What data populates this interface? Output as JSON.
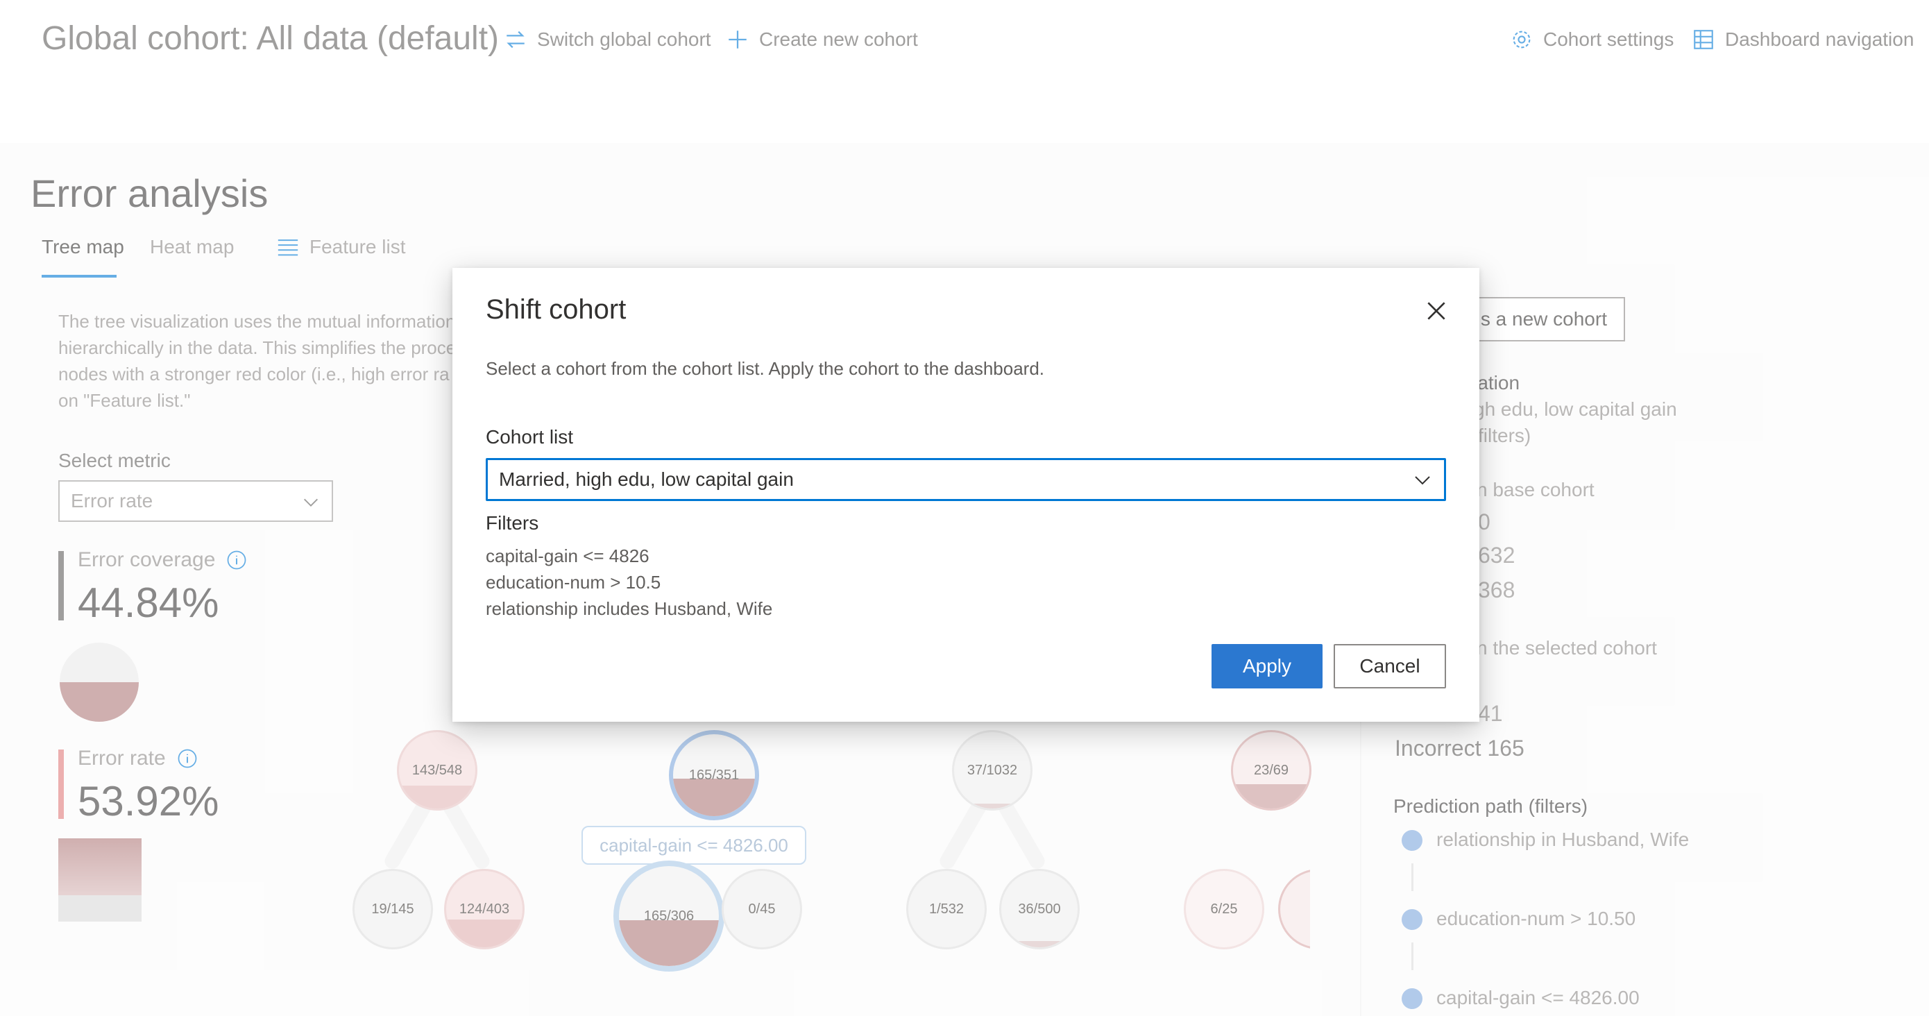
{
  "header": {
    "title": "Global cohort: All data (default)",
    "switch_cohort": "Switch global cohort",
    "create_cohort": "Create new cohort",
    "cohort_settings": "Cohort settings",
    "dashboard_navigation": "Dashboard navigation"
  },
  "error_analysis": {
    "title": "Error analysis",
    "tabs": [
      {
        "label": "Tree map",
        "active": true
      },
      {
        "label": "Heat map",
        "active": false
      },
      {
        "label": "Feature list",
        "active": false
      }
    ],
    "description_lines": [
      "The tree visualization uses the mutual information",
      "hierarchically in the data. This simplifies the proce",
      "nodes with a stronger red color (i.e., high error ra",
      "on \"Feature list.\""
    ],
    "select_metric_label": "Select metric",
    "select_metric_value": "Error rate",
    "error_coverage_label": "Error coverage",
    "error_coverage_value": "44.84%",
    "error_rate_label": "Error rate",
    "error_rate_value": "53.92%"
  },
  "tree": {
    "node_labels": [
      "143/548",
      "165/351",
      "37/1032",
      "23/69",
      "19/145",
      "124/403",
      "165/306",
      "0/45",
      "1/532",
      "36/500",
      "6/25"
    ],
    "split_label": "capital-gain <= 4826.00"
  },
  "side_panel": {
    "save_cohort_button": "s a new cohort",
    "info_title": "mation",
    "info_line1": "gh edu, low capital gain",
    "info_line2": "filters)",
    "base_cohort_label": "n base cohort",
    "base_val1": "0",
    "base_val2": "632",
    "base_val3": "368",
    "selected_cohort_label": "n the selected cohort",
    "selected_val1": "41",
    "incorrect": "Incorrect 165",
    "prediction_path_title": "Prediction path (filters)",
    "prediction_path": [
      "relationship in Husband, Wife",
      "education-num > 10.50",
      "capital-gain <= 4826.00"
    ]
  },
  "dialog": {
    "title": "Shift cohort",
    "subtitle": "Select a cohort from the cohort list. Apply the cohort to the dashboard.",
    "cohort_list_label": "Cohort list",
    "cohort_selected": "Married, high edu, low capital gain",
    "filters_label": "Filters",
    "filters": [
      "capital-gain <= 4826",
      "education-num > 10.5",
      "relationship includes Husband, Wife"
    ],
    "apply": "Apply",
    "cancel": "Cancel"
  },
  "colors": {
    "accent": "#0078d4",
    "primary_button": "#2b78d0",
    "error_red": "#b07a7a",
    "path_dot": "#7ea7dc"
  }
}
